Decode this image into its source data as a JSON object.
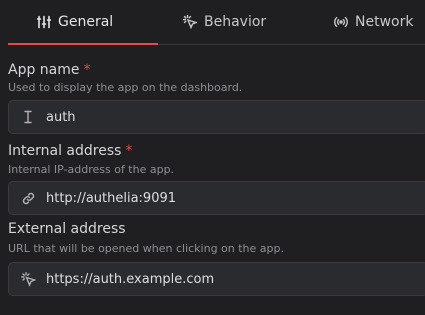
{
  "tabs": [
    {
      "label": "General",
      "icon": "settings-sliders-icon",
      "active": true
    },
    {
      "label": "Behavior",
      "icon": "sparkle-click-icon",
      "active": false
    },
    {
      "label": "Network",
      "icon": "broadcast-icon",
      "active": false
    }
  ],
  "accent_color": "#e5484d",
  "fields": {
    "app_name": {
      "label": "App name",
      "required_mark": "*",
      "description": "Used to display the app on the dashboard.",
      "value": "auth",
      "icon": "text-cursor-icon"
    },
    "internal_address": {
      "label": "Internal address",
      "required_mark": "*",
      "description": "Internal IP-address of the app.",
      "value": "http://authelia:9091",
      "icon": "link-icon"
    },
    "external_address": {
      "label": "External address",
      "description": "URL that will be opened when clicking on the app.",
      "value": "https://auth.example.com",
      "icon": "click-icon"
    }
  }
}
